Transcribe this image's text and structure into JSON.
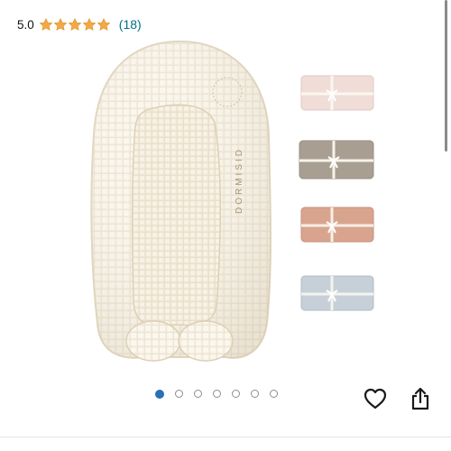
{
  "rating": {
    "value": "5.0",
    "stars_filled": 5,
    "star_color": "#f3a847",
    "review_count": "(18)",
    "link_color": "#007185"
  },
  "product_image": {
    "brand_text": "DORMISID",
    "main_color": "#f4eee0",
    "swatches": [
      {
        "name": "pink",
        "color": "#f0ddd8"
      },
      {
        "name": "taupe",
        "color": "#a89f92"
      },
      {
        "name": "terracotta",
        "color": "#d9a48e"
      },
      {
        "name": "blue",
        "color": "#c7d0d8"
      }
    ]
  },
  "carousel": {
    "total": 7,
    "active_index": 0,
    "active_color": "#2b6fb7"
  },
  "icons": {
    "wishlist": "heart-icon",
    "share": "share-icon"
  }
}
